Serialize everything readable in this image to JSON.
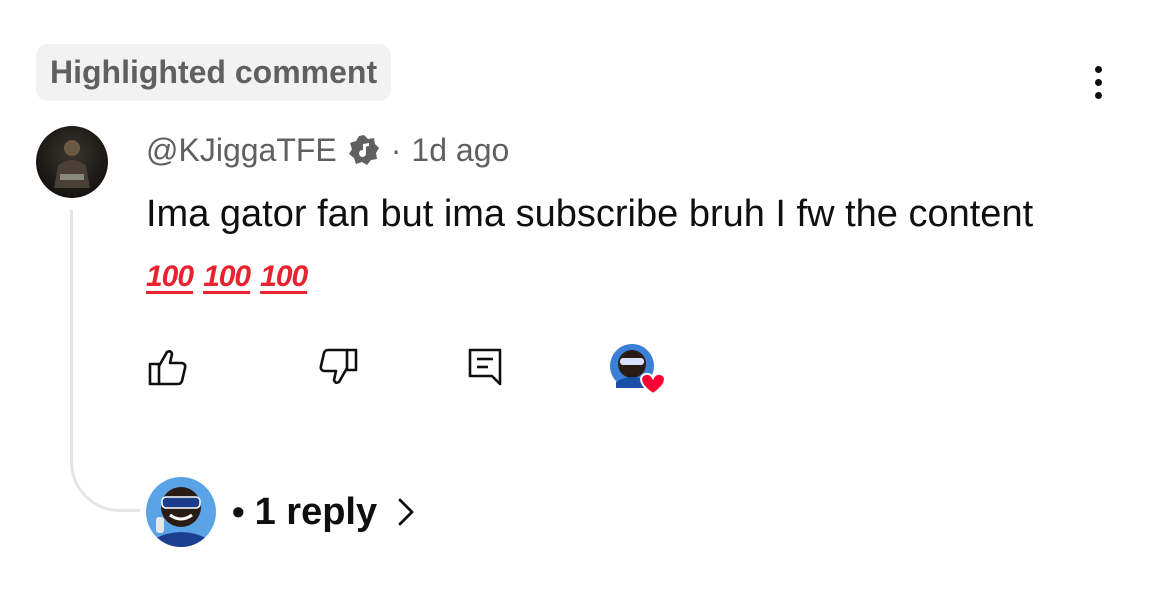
{
  "badge": {
    "label": "Highlighted comment"
  },
  "comment": {
    "author": "@KJiggaTFE",
    "separator": "·",
    "time": "1d ago",
    "text": "Ima gator fan but ima subscribe bruh I fw the content",
    "emojis": [
      "100",
      "100",
      "100"
    ]
  },
  "actions": {
    "like_icon": "thumb-up-icon",
    "dislike_icon": "thumb-down-icon",
    "reply_icon": "comment-reply-icon",
    "creator_heart": "creator-heart-icon"
  },
  "replies": {
    "separator": "•",
    "label": "1 reply"
  },
  "colors": {
    "heart": "#ff0033",
    "emoji_red": "#e8232f",
    "secondary_text": "#606060",
    "badge_bg": "#f2f2f2"
  }
}
